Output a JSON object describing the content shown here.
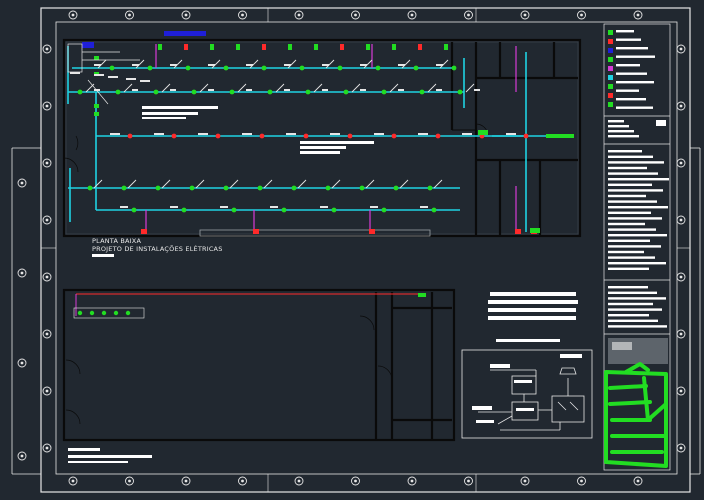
{
  "drawing": {
    "plan_title": "PLANTA BAIXA",
    "plan_subtitle": "PROJETO DE INSTALAÇÕES ELÉTRICAS"
  },
  "grid": {
    "top_bubble_count": 11,
    "left_bubble_count": 8,
    "right_bubble_count": 8
  },
  "colors": {
    "background": "#212830",
    "sheet_border": "#e6e6e6",
    "wall": "#000000",
    "circuit_conduit": "#1fd3e3",
    "power_circuit": "#ff2a2a",
    "device_green": "#22dd22",
    "device_magenta": "#d63bd6",
    "highlight_blue": "#1f1fd8",
    "stamp_green": "#22dd22"
  }
}
